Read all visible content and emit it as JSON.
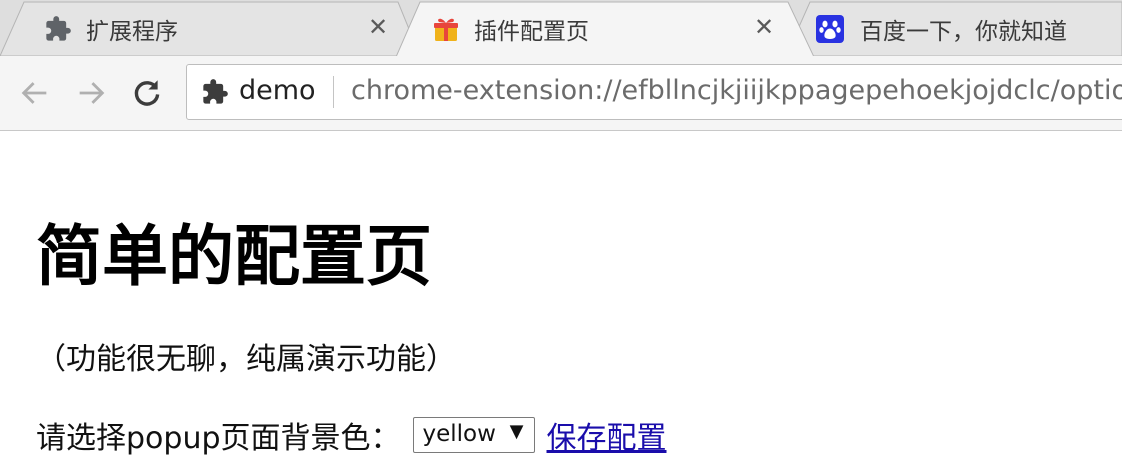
{
  "tabs": [
    {
      "title": "扩展程序",
      "icon": "puzzle-icon",
      "close": "✕",
      "active": false
    },
    {
      "title": "插件配置页",
      "icon": "gift-icon",
      "close": "✕",
      "active": true
    },
    {
      "title": "百度一下，你就知道",
      "icon": "baidu-paw-icon",
      "active": false
    }
  ],
  "toolbar": {
    "back_icon": "arrow-left-icon",
    "forward_icon": "arrow-right-icon",
    "reload_icon": "reload-icon",
    "omnibox": {
      "chip_icon": "puzzle-icon",
      "chip_label": "demo",
      "url": "chrome-extension://efbllncjkjiijkppagepehoekjojdclc/optio"
    }
  },
  "page": {
    "title": "简单的配置页",
    "description": "（功能很无聊，纯属演示功能）",
    "option_label": "请选择popup页面背景色：",
    "color_select": {
      "selected": "yellow",
      "arrow": "▼"
    },
    "save_link": "保存配置"
  },
  "colors": {
    "tabstrip_bg": "#dedede",
    "active_tab_bg": "#f5f5f5",
    "link": "#1a0dab",
    "baidu_blue": "#2932e1"
  }
}
